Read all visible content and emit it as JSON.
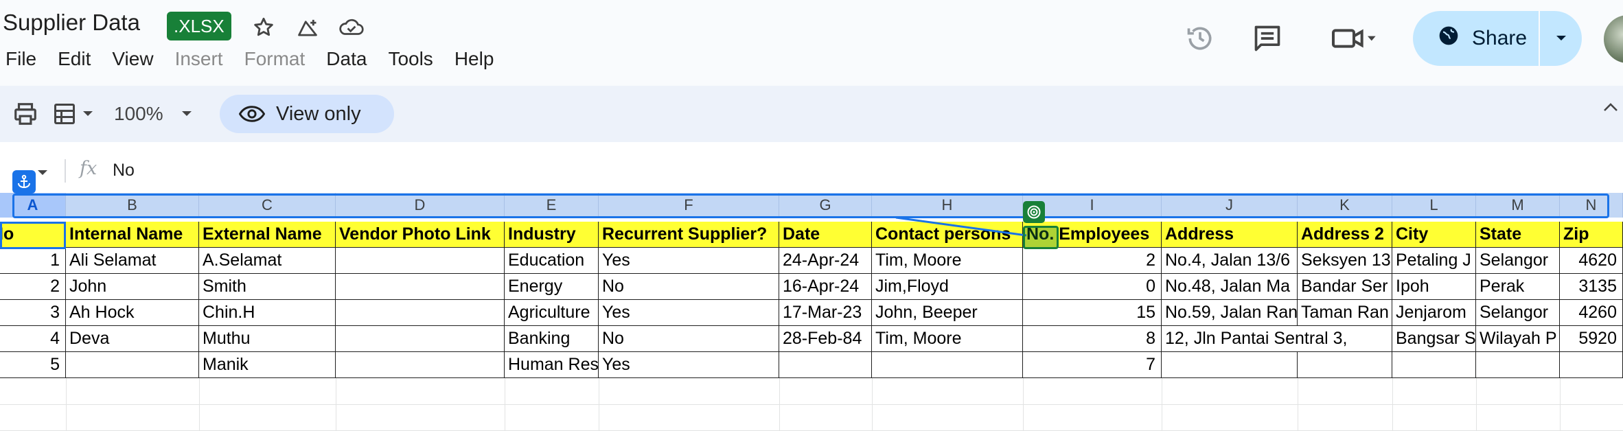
{
  "header": {
    "title": "Supplier Data",
    "badge": ".XLSX",
    "menu": [
      {
        "label": "File",
        "enabled": true
      },
      {
        "label": "Edit",
        "enabled": true
      },
      {
        "label": "View",
        "enabled": true
      },
      {
        "label": "Insert",
        "enabled": false
      },
      {
        "label": "Format",
        "enabled": false
      },
      {
        "label": "Data",
        "enabled": true
      },
      {
        "label": "Tools",
        "enabled": true
      },
      {
        "label": "Help",
        "enabled": true
      }
    ],
    "share_label": "Share"
  },
  "toolbar": {
    "zoom": "100%",
    "view_only_label": "View only"
  },
  "formula_bar": {
    "fx_label": "fx",
    "value": "No"
  },
  "grid": {
    "column_letters": [
      "A",
      "B",
      "C",
      "D",
      "E",
      "F",
      "G",
      "H",
      "I",
      "J",
      "K",
      "L",
      "M",
      "N"
    ],
    "selected_column": "A",
    "header_row": [
      "No",
      "Internal Name",
      "External Name",
      "Vendor Photo Link",
      "Industry",
      "Recurrent Supplier?",
      "Date",
      "Contact persons",
      "No. Employees",
      "Address",
      "Address 2",
      "City",
      "State",
      "Zip"
    ],
    "rows": [
      [
        "1",
        "Ali Selamat",
        "A.Selamat",
        "",
        "Education",
        "Yes",
        "24-Apr-24",
        "Tim, Moore",
        "2",
        "No.4, Jalan 13/6",
        "Seksyen 13",
        "Petaling J",
        "Selangor",
        "4620"
      ],
      [
        "2",
        "John",
        "Smith",
        "",
        "Energy",
        "No",
        "16-Apr-24",
        "Jim,Floyd",
        "0",
        "No.48, Jalan Ma",
        "Bandar Ser",
        "Ipoh",
        "Perak",
        "3135"
      ],
      [
        "3",
        "Ah Hock",
        "Chin.H",
        "",
        "Agriculture",
        "Yes",
        "17-Mar-23",
        "John, Beeper",
        "15",
        "No.59, Jalan Ran",
        "Taman Ran",
        "Jenjarom",
        "Selangor",
        "4260"
      ],
      [
        "4",
        "Deva",
        "Muthu",
        "",
        "Banking",
        "No",
        "28-Feb-84",
        "Tim, Moore",
        "8",
        "12, Jln Pantai Sentral 3,",
        "",
        "Bangsar S",
        "Wilayah P",
        "5920"
      ],
      [
        "5",
        "",
        "Manik",
        "",
        "Human Res",
        "Yes",
        "",
        "",
        "7",
        "",
        "",
        "",
        "",
        ""
      ]
    ]
  },
  "colors": {
    "header_fill": "#ffff33",
    "selection": "#1a73e8",
    "badge": "#188038"
  }
}
